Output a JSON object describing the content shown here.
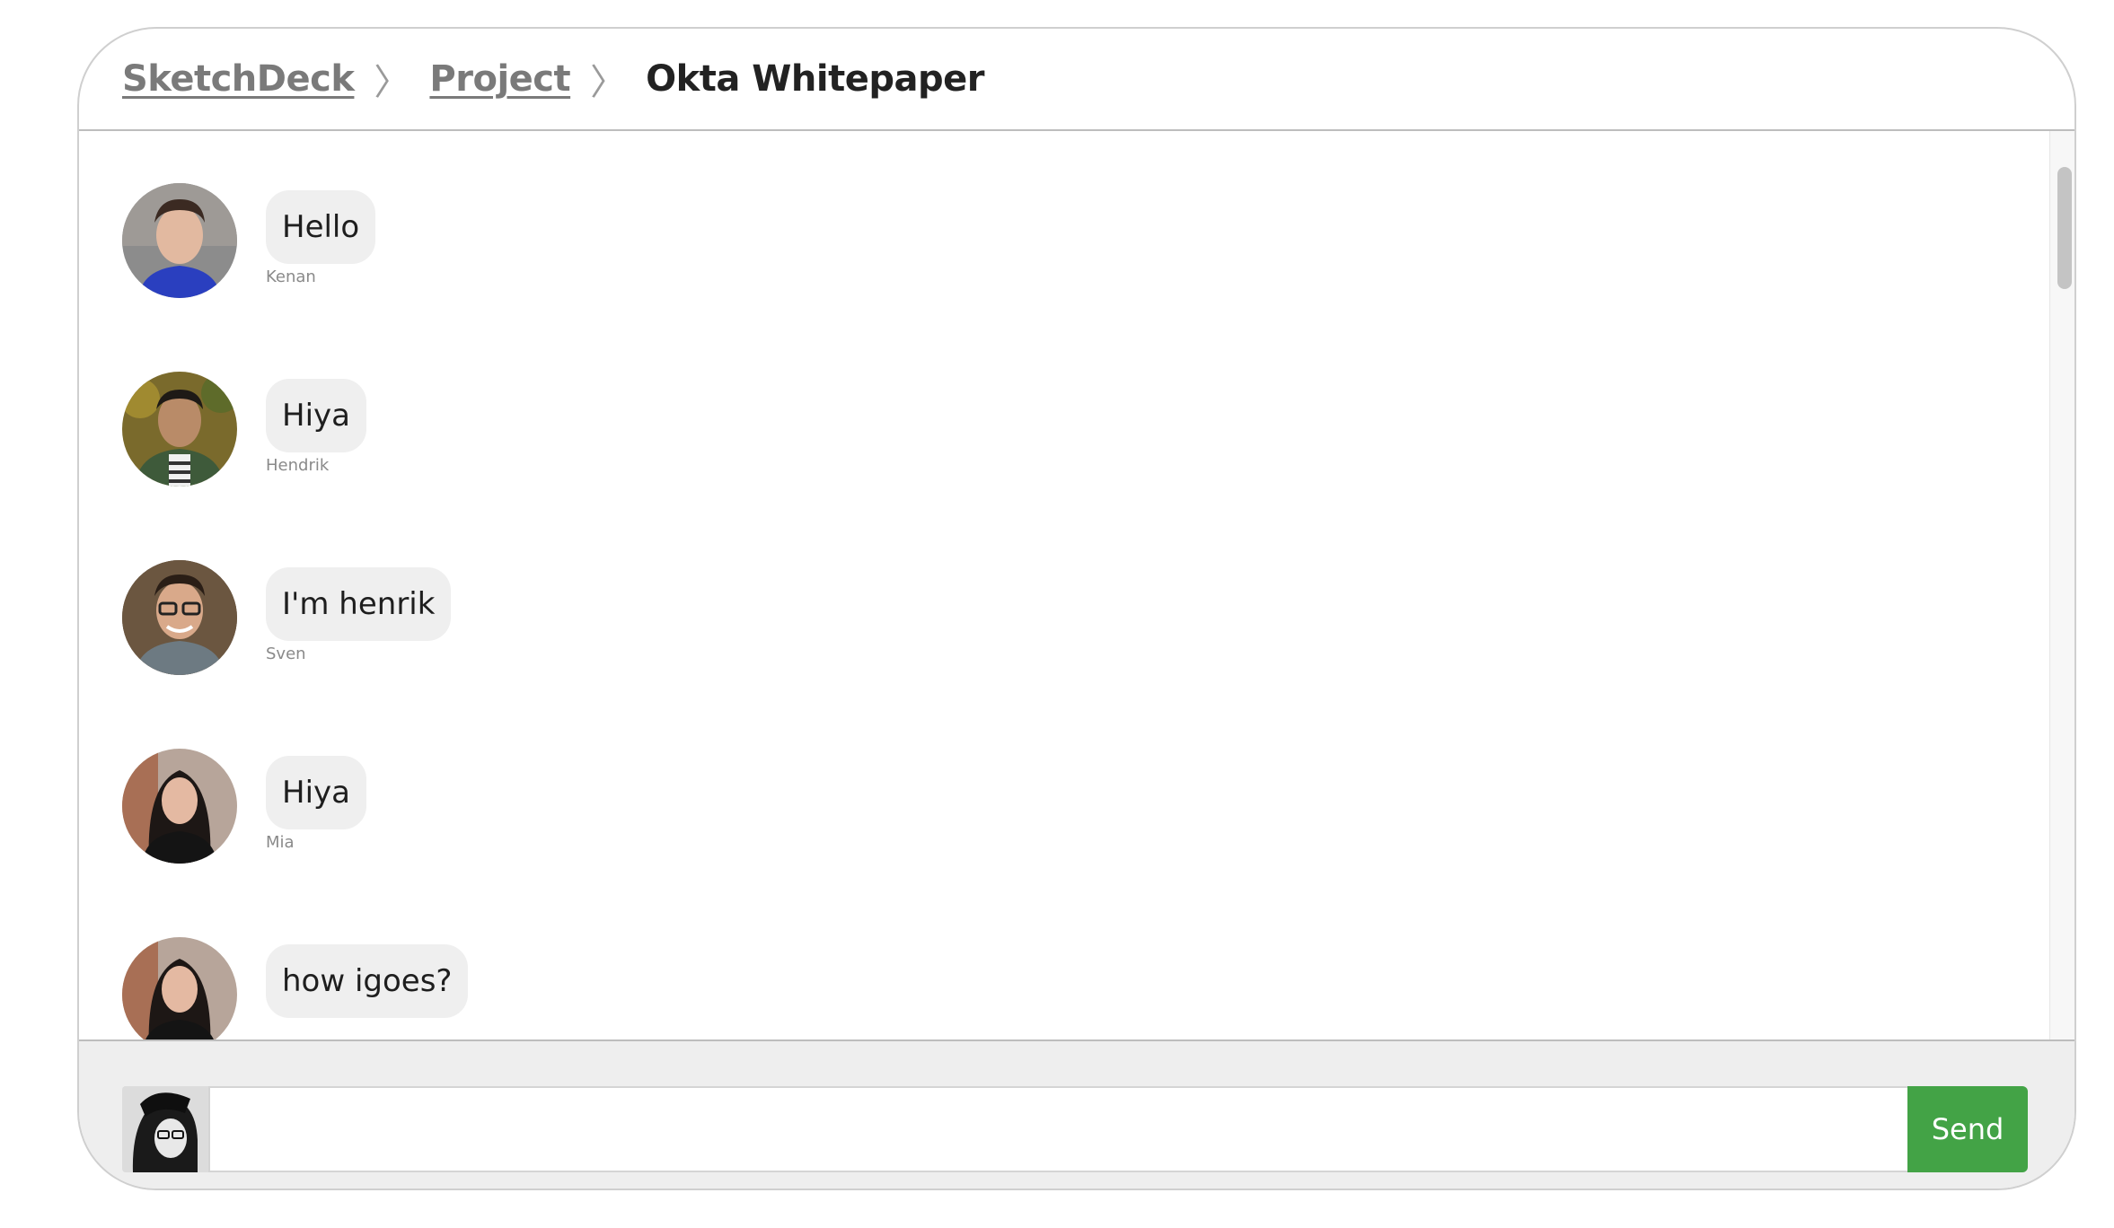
{
  "breadcrumb": {
    "items": [
      {
        "label": "SketchDeck"
      },
      {
        "label": "Project"
      }
    ],
    "separator": "〉",
    "current": "Okta Whitepaper"
  },
  "messages": [
    {
      "text": "Hello",
      "author": "Kenan",
      "avatar_icon": "person-avatar-icon"
    },
    {
      "text": "Hiya",
      "author": "Hendrik",
      "avatar_icon": "person-avatar-icon"
    },
    {
      "text": "I'm henrik",
      "author": "Sven",
      "avatar_icon": "person-avatar-icon"
    },
    {
      "text": "Hiya",
      "author": "Mia",
      "avatar_icon": "person-avatar-icon"
    },
    {
      "text": "how igoes?",
      "author": "",
      "avatar_icon": "person-avatar-icon"
    }
  ],
  "composer": {
    "input_value": "",
    "input_placeholder": "",
    "send_label": "Send"
  },
  "colors": {
    "send_button": "#43a346",
    "bubble_bg": "#efefef",
    "composer_bg": "#eeeeee",
    "crumb_link": "#7a7a7a"
  }
}
